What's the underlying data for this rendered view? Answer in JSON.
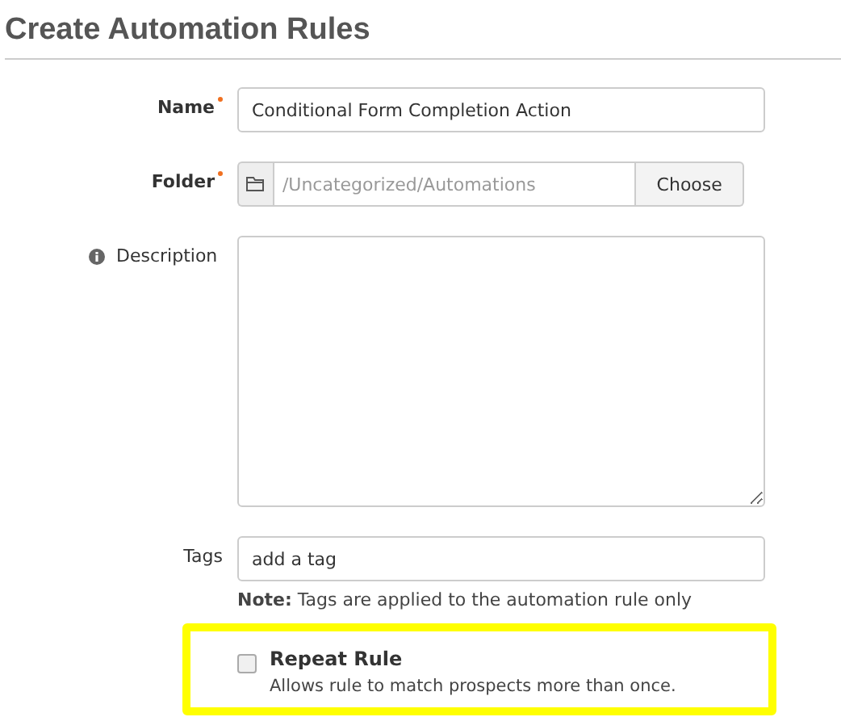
{
  "title": "Create Automation Rules",
  "fields": [
    {
      "kind": "text",
      "label": "Name",
      "required": true,
      "value": "Conditional Form Completion Action"
    },
    {
      "kind": "folder",
      "label": "Folder",
      "required": true,
      "value": "/Uncategorized/Automations",
      "button": "Choose"
    },
    {
      "kind": "textarea",
      "label": "Description",
      "required": false,
      "info": true
    },
    {
      "kind": "tags",
      "label": "Tags",
      "required": false,
      "placeholder": "add a tag",
      "note": "**Note:** Tags are applied to the automation rule only"
    }
  ],
  "repeat_rule": {
    "label": "Repeat Rule",
    "description": "Allows rule to match prospects more than once.",
    "checked": false,
    "highlighted": true
  }
}
